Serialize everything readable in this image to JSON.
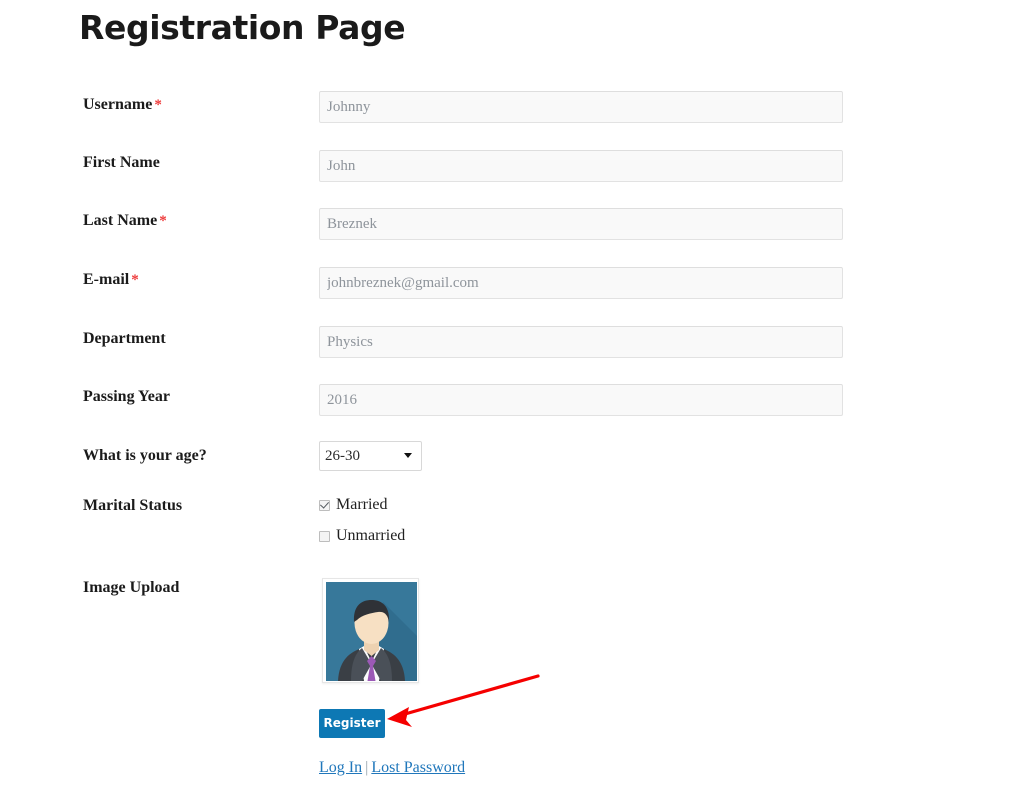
{
  "page": {
    "title": "Registration Page",
    "required_marker": "*",
    "background_color": "#ffffff"
  },
  "form": {
    "fields": [
      {
        "label": "Username",
        "required": true,
        "type": "text",
        "value": "Johnny",
        "placeholder": "Johnny"
      },
      {
        "label": "First Name",
        "required": false,
        "type": "text",
        "value": "John",
        "placeholder": "John"
      },
      {
        "label": "Last Name",
        "required": true,
        "type": "text",
        "value": "Breznek",
        "placeholder": "Breznek"
      },
      {
        "label": "E-mail",
        "required": true,
        "type": "email",
        "value": "johnbreznek@gmail.com",
        "placeholder": "johnbreznek@gmail.com"
      },
      {
        "label": "Department",
        "required": false,
        "type": "text",
        "value": "Physics",
        "placeholder": "Physics"
      },
      {
        "label": "Passing Year",
        "required": false,
        "type": "text",
        "value": "2016",
        "placeholder": "2016"
      }
    ],
    "age": {
      "label": "What is your age?",
      "selected": "26-30",
      "options": [
        "26-30"
      ]
    },
    "marital_status": {
      "label": "Marital Status",
      "options": [
        {
          "label": "Married",
          "checked": true
        },
        {
          "label": "Unmarried",
          "checked": false
        }
      ]
    },
    "image_upload": {
      "label": "Image Upload",
      "preview_alt": "user-avatar-photo"
    },
    "submit": {
      "label": "Register",
      "color": "#0d78b4"
    },
    "links": {
      "login": "Log In",
      "separator": "|",
      "lost_password": "Lost Password",
      "color": "#2077bb"
    }
  },
  "annotation": {
    "arrow_color": "#f50000",
    "points_to": "Register"
  }
}
